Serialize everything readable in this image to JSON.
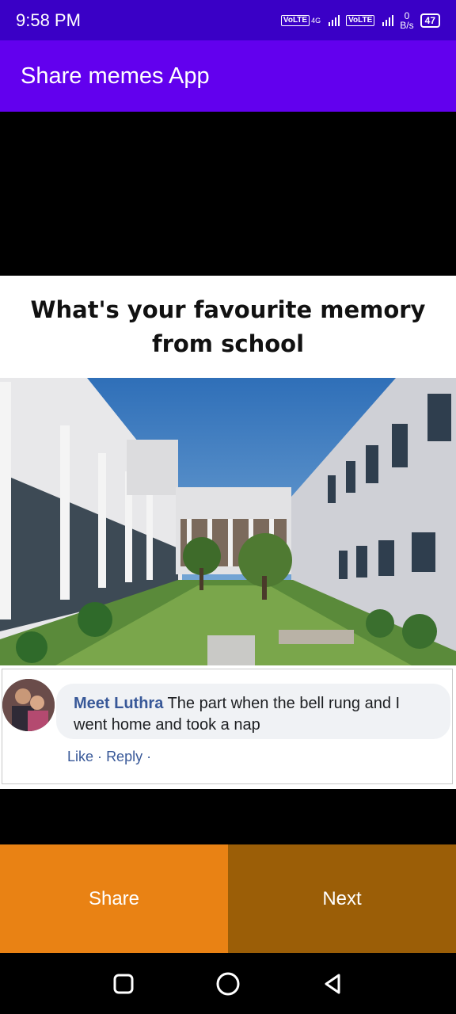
{
  "status_bar": {
    "time": "9:58 PM",
    "volte1": "VoLTE",
    "network_type": "4G",
    "volte2": "VoLTE",
    "net_speed_value": "0",
    "net_speed_unit": "B/s",
    "battery": "47"
  },
  "app_bar": {
    "title": "Share memes App"
  },
  "meme": {
    "caption": "What's your favourite memory from school",
    "comment": {
      "author": "Meet Luthra",
      "text": "The part when the bell rung and I went home and took a nap",
      "like": "Like",
      "separator": "·",
      "reply": "Reply",
      "trailing": "·"
    }
  },
  "buttons": {
    "share": "Share",
    "next": "Next"
  },
  "nav": {
    "recents_icon": "square-icon",
    "home_icon": "circle-icon",
    "back_icon": "triangle-back-icon"
  },
  "colors": {
    "status_bar": "#3a00c6",
    "app_bar": "#6200ee",
    "share_button": "#e98214",
    "next_button": "#9b5e07"
  }
}
